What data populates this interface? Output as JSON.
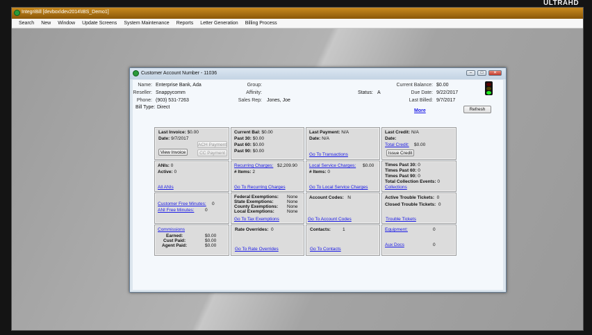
{
  "watermark": "ULTRAHD",
  "app": {
    "title": "IntegriBill [devbox\\dev2014\\IBS_Demo1]",
    "menu": [
      "Search",
      "New",
      "Window",
      "Update Screens",
      "System Maintenance",
      "Reports",
      "Letter Generation",
      "Billing Process"
    ]
  },
  "dialog": {
    "title": "Customer Account Number - 11036",
    "header": {
      "name_label": "Name:",
      "name": "Enterprise Bank, Ada",
      "reseller_label": "Reseller:",
      "reseller": "Snappycomm",
      "phone_label": "Phone:",
      "phone": "(903) 531-7263",
      "bill_type_label": "Bill Type:",
      "bill_type": "Direct",
      "group_label": "Group:",
      "affinity_label": "Affinity:",
      "sales_rep_label": "Sales Rep:",
      "sales_rep": "Jones, Joe",
      "status_label": "Status:",
      "status": "A",
      "balance_label": "Current Balance:",
      "balance": "$0.00",
      "due_label": "Due Date:",
      "due": "9/22/2017",
      "billed_label": "Last Billed:",
      "billed": "9/7/2017",
      "more": "More",
      "refresh": "Refresh"
    },
    "status_light": {
      "red": "#5a0000",
      "yellow": "#4a4000",
      "green": "#22ee22"
    },
    "invoice": {
      "last_label": "Last Invoice:",
      "last": "$0.00",
      "date_label": "Date:",
      "date": "9/7/2017",
      "ach": "ACH Payment",
      "cc": "CC Payment",
      "view": "View Invoice"
    },
    "balance": {
      "cur_label": "Current Bal:",
      "cur": "$0.00",
      "p30_label": "Past 30:",
      "p30": "$0.00",
      "p60_label": "Past 60:",
      "p60": "$0.00",
      "p90_label": "Past 90:",
      "p90": "$0.00"
    },
    "payment": {
      "last_label": "Last Payment:",
      "last": "N/A",
      "date_label": "Date:",
      "date": "N/A",
      "link": "Go To Transactions"
    },
    "credit": {
      "last_label": "Last Credit:",
      "last": "N/A",
      "date_label": "Date:",
      "total_link": "Total Credit:",
      "total": "$0.00",
      "issue": "Issue Credit"
    },
    "anis": {
      "anis_label": "ANIs:",
      "anis": "0",
      "active_label": "Active:",
      "active": "0",
      "link": "All ANIs"
    },
    "recurring": {
      "link_label": "Recurring Charges:",
      "amount": "$2,209.90",
      "items_label": "# Items:",
      "items": "2",
      "link": "Go To Recurring Charges"
    },
    "local": {
      "link_label": "Local Service Charges:",
      "amount": "$0.00",
      "items_label": "# Items:",
      "items": "0",
      "link": "Go To Local Service Charges"
    },
    "collections": {
      "p30_label": "Times Past 30:",
      "p30": "0",
      "p60_label": "Times Past 60:",
      "p60": "0",
      "p90_label": "Times Past 90:",
      "p90": "0",
      "total_label": "Total Collection Events:",
      "total": "0",
      "link": "Collections"
    },
    "minutes": {
      "cust_link": "Customer Free Minutes:",
      "cust": "0",
      "ani_link": "ANI Free Minutes:",
      "ani": "0"
    },
    "exemptions": {
      "fed_label": "Federal Exemptions:",
      "fed": "None",
      "state_label": "State Exemptions:",
      "state": "None",
      "county_label": "County Exemptions:",
      "county": "None",
      "local_label": "Local Exemptions:",
      "local": "None",
      "link": "Go To Tax Exemptions"
    },
    "codes": {
      "label": "Account Codes:",
      "value": "N",
      "link": "Go To Account Codes"
    },
    "tickets": {
      "active_label": "Active Trouble Tickets:",
      "active": "0",
      "closed_label": "Closed Trouble Tickets:",
      "closed": "0",
      "link": "Trouble Tickets"
    },
    "commissions": {
      "link": "Commissions",
      "earned_label": "Earned:",
      "earned": "$0.00",
      "cust_label": "Cust Paid:",
      "cust": "$0.00",
      "agent_label": "Agent Paid:",
      "agent": "$0.00"
    },
    "rates": {
      "label": "Rate Overrides:",
      "value": "0",
      "link": "Go To Rate Overrides"
    },
    "contacts": {
      "label": "Contacts:",
      "value": "1",
      "link": "Go To Contacts"
    },
    "equipment": {
      "link": "Equipment:",
      "value": "0",
      "aux_link": "Aux Docs",
      "aux": "0"
    }
  }
}
